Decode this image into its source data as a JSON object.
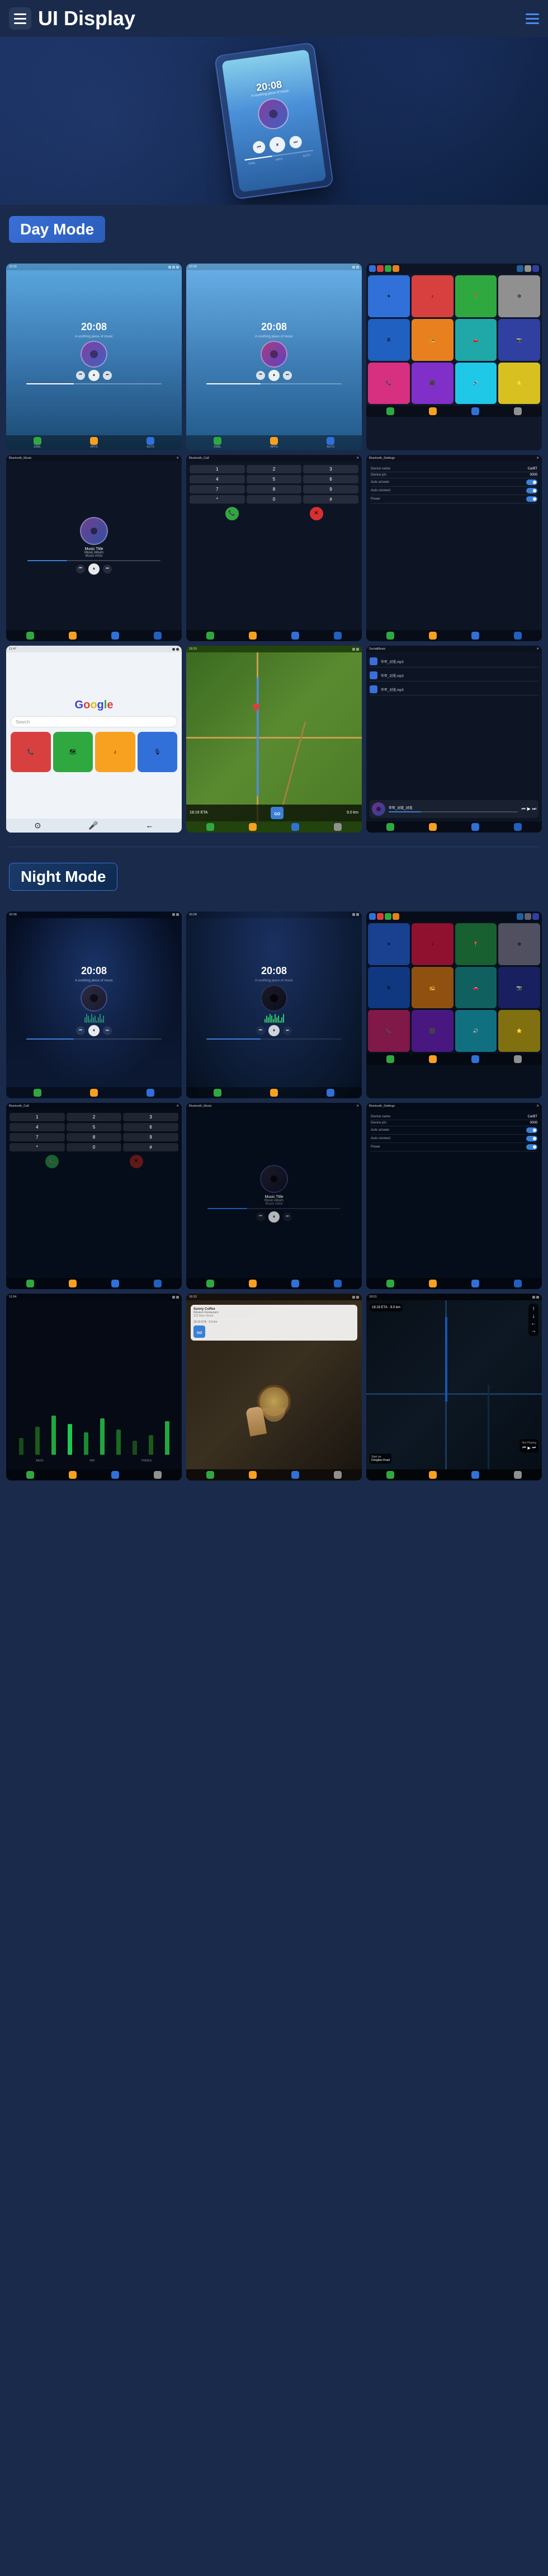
{
  "header": {
    "title": "UI Display",
    "menu_icon": "☰",
    "dots_icon": "⋮"
  },
  "day_mode": {
    "label": "Day Mode",
    "screens": [
      {
        "type": "music",
        "time": "20:08",
        "subtitle": "A soothing piece of music"
      },
      {
        "type": "music2",
        "time": "20:08",
        "subtitle": "A soothing piece of music"
      },
      {
        "type": "home_apps"
      },
      {
        "type": "bluetooth_music",
        "title": "Bluetooth_Music",
        "song": "Music Title",
        "album": "Music Album",
        "artist": "Music Artist"
      },
      {
        "type": "bluetooth_call",
        "title": "Bluetooth_Call"
      },
      {
        "type": "bluetooth_settings",
        "title": "Bluetooth_Settings",
        "device_name_label": "Device name",
        "device_name": "CarBT",
        "device_pin_label": "Device pin",
        "device_pin": "0000",
        "auto_answer_label": "Auto answer",
        "auto_connect_label": "Auto connect",
        "power_label": "Power"
      },
      {
        "type": "google_carplay",
        "logo": "Google"
      },
      {
        "type": "navigation",
        "eta": "18:19 ETA",
        "distance": "9.0 km"
      },
      {
        "type": "social_music",
        "title": "SocialMusic"
      }
    ]
  },
  "night_mode": {
    "label": "Night Mode",
    "screens": [
      {
        "type": "music_night",
        "time": "20:08"
      },
      {
        "type": "music_night2",
        "time": "20:08"
      },
      {
        "type": "home_apps_night"
      },
      {
        "type": "bluetooth_call_night",
        "title": "Bluetooth_Call"
      },
      {
        "type": "bluetooth_music_night",
        "title": "Bluetooth_Music",
        "song": "Music Title",
        "album": "Music Album",
        "artist": "Music Artist"
      },
      {
        "type": "bluetooth_settings_night",
        "title": "Bluetooth_Settings"
      },
      {
        "type": "eq_night"
      },
      {
        "type": "food_nav"
      },
      {
        "type": "nav_night"
      }
    ]
  },
  "bottom_nav": {
    "items": [
      "SNAL",
      "APFS",
      "AUTO"
    ]
  },
  "music": {
    "title": "Music Title",
    "album": "Music Album",
    "artist": "Music Artist"
  },
  "night_mode_label": "Night Mode",
  "day_mode_label": "Day Mode"
}
